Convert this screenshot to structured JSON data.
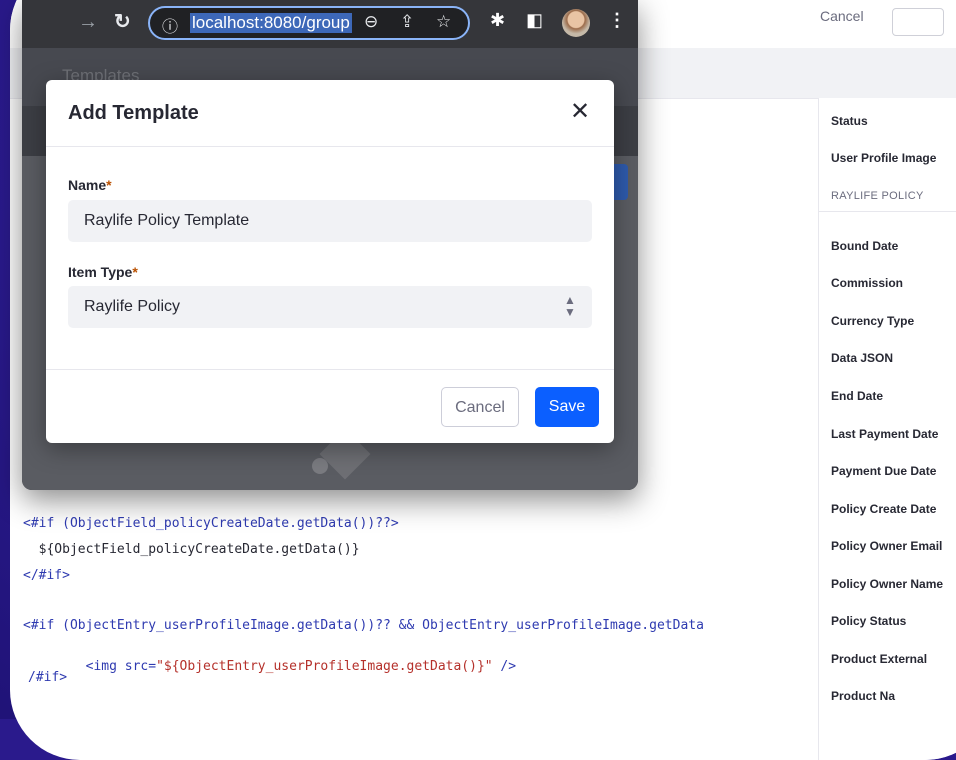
{
  "browser": {
    "url": "localhost:8080/group",
    "tab_title": "Templates"
  },
  "editor_top": {
    "cancel_label": "Cancel"
  },
  "modal": {
    "title": "Add Template",
    "name_label": "Name",
    "name_value": "Raylife Policy Template",
    "item_type_label": "Item Type",
    "item_type_value": "Raylife Policy",
    "required_mark": "*",
    "cancel_label": "Cancel",
    "save_label": "Save"
  },
  "sidepanel": {
    "items_top": [
      "Status",
      "User Profile Image"
    ],
    "section_header": "RAYLIFE POLICY",
    "items": [
      "Bound Date",
      "Commission",
      "Currency Type",
      "Data JSON",
      "End Date",
      "Last Payment Date",
      "Payment Due Date",
      "Policy Create Date",
      "Policy Owner Email",
      "Policy Owner Name",
      "Policy Status",
      "Product External",
      "Product Na"
    ]
  },
  "code": {
    "line1": "<#if (ObjectField_policyCreateDate.getData())??>",
    "line2": "  ${ObjectField_policyCreateDate.getData()}",
    "line3": "</#if>",
    "line4": "<#if (ObjectEntry_userProfileImage.getData())?? && ObjectEntry_userProfileImage.getData",
    "line5_a": "  <img src=",
    "line5_b": "\"${ObjectEntry_userProfileImage.getData()}\"",
    "line5_c": " />",
    "line6": "/#if>"
  }
}
